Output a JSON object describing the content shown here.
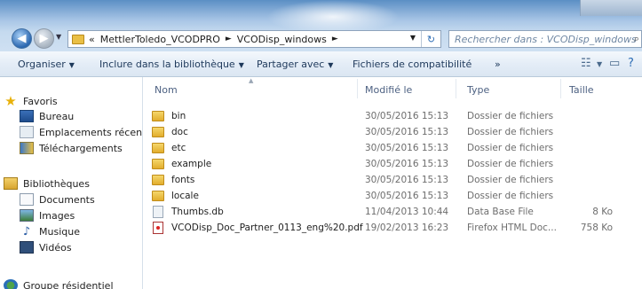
{
  "address": {
    "prefix": "«",
    "segments": [
      "MettlerToledo_VCODPRO",
      "VCODisp_windows"
    ],
    "separator": "►",
    "dropdown": "▼",
    "refresh": "↻"
  },
  "search": {
    "placeholder": "Rechercher dans : VCODisp_windows"
  },
  "toolbar": {
    "organize": "Organiser",
    "include_library": "Inclure dans la bibliothèque",
    "share_with": "Partager avec",
    "compatibility": "Fichiers de compatibilité",
    "more": "»",
    "dropdown_arrow": "▼"
  },
  "navpane": {
    "favorites": "Favoris",
    "desktop": "Bureau",
    "recent_places": "Emplacements récents",
    "downloads": "Téléchargements",
    "libraries": "Bibliothèques",
    "documents": "Documents",
    "images": "Images",
    "music": "Musique",
    "videos": "Vidéos",
    "homegroup": "Groupe résidentiel"
  },
  "columns": {
    "name": "Nom",
    "modified": "Modifié le",
    "type": "Type",
    "size": "Taille"
  },
  "files": [
    {
      "name": "bin",
      "modified": "30/05/2016 15:13",
      "type": "Dossier de fichiers",
      "size": ""
    },
    {
      "name": "doc",
      "modified": "30/05/2016 15:13",
      "type": "Dossier de fichiers",
      "size": ""
    },
    {
      "name": "etc",
      "modified": "30/05/2016 15:13",
      "type": "Dossier de fichiers",
      "size": ""
    },
    {
      "name": "example",
      "modified": "30/05/2016 15:13",
      "type": "Dossier de fichiers",
      "size": ""
    },
    {
      "name": "fonts",
      "modified": "30/05/2016 15:13",
      "type": "Dossier de fichiers",
      "size": ""
    },
    {
      "name": "locale",
      "modified": "30/05/2016 15:13",
      "type": "Dossier de fichiers",
      "size": ""
    },
    {
      "name": "Thumbs.db",
      "modified": "11/04/2013 10:44",
      "type": "Data Base File",
      "size": "8 Ko"
    },
    {
      "name": "VCODisp_Doc_Partner_0113_eng%20.pdf",
      "modified": "19/02/2013 16:23",
      "type": "Firefox HTML Doc...",
      "size": "758 Ko"
    }
  ]
}
